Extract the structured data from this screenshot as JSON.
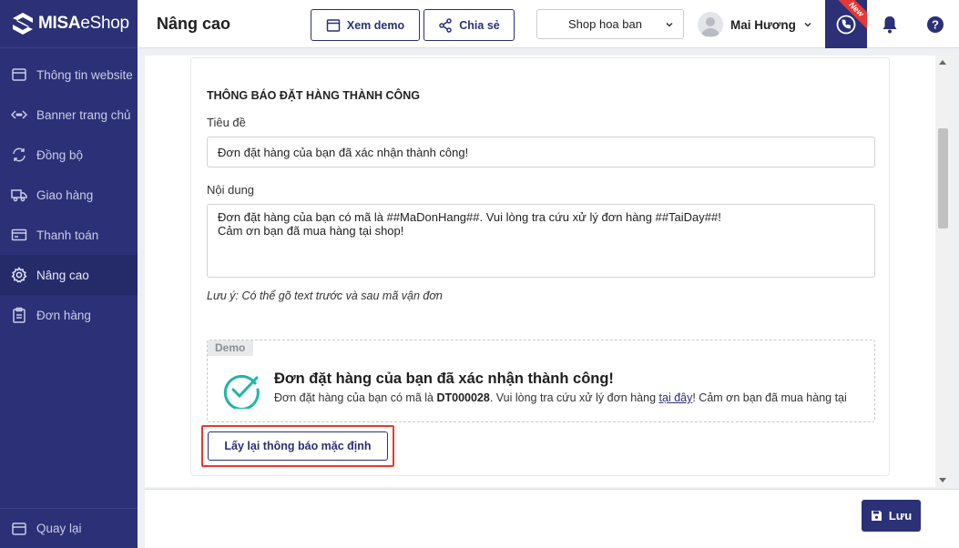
{
  "brand": {
    "name_bold": "MISA",
    "name_thin": "eShop"
  },
  "sidebar": {
    "items": [
      {
        "label": "Thông tin website",
        "icon": "browser-icon"
      },
      {
        "label": "Banner trang chủ",
        "icon": "banner-icon"
      },
      {
        "label": "Đồng bộ",
        "icon": "sync-icon"
      },
      {
        "label": "Giao hàng",
        "icon": "truck-icon"
      },
      {
        "label": "Thanh toán",
        "icon": "card-icon"
      },
      {
        "label": "Nâng cao",
        "icon": "gear-icon",
        "active": true
      },
      {
        "label": "Đơn hàng",
        "icon": "clipboard-icon"
      }
    ],
    "back_label": "Quay lại"
  },
  "header": {
    "title": "Nâng cao",
    "demo_button": "Xem demo",
    "share_button": "Chia sẻ",
    "shop_select": "Shop hoa ban",
    "user_name": "Mai Hương",
    "new_badge": "New"
  },
  "form": {
    "section_title": "THÔNG BÁO ĐẶT HÀNG THÀNH CÔNG",
    "title_label": "Tiêu đề",
    "title_value": "Đơn đặt hàng của bạn đã xác nhận thành công!",
    "content_label": "Nội dung",
    "content_value": "Đơn đặt hàng của bạn có mã là ##MaDonHang##. Vui lòng tra cứu xử lý đơn hàng ##TaiDay##!\nCảm ơn bạn đã mua hàng tại shop!",
    "note": "Lưu ý: Có thể gõ text trước và sau mã vận đơn"
  },
  "demo": {
    "tag": "Demo",
    "heading": "Đơn đặt hàng của bạn đã xác nhận thành công!",
    "text_before": "Đơn đặt hàng của bạn có mã là ",
    "order_code": "DT000028",
    "text_middle": ". Vui lòng tra cứu xử lý đơn hàng ",
    "link_text": "tại đây",
    "text_after": "! Cảm ơn bạn đã mua hàng tại"
  },
  "reset_button": "Lấy lại thông báo mặc định",
  "footer": {
    "save_button": "Lưu"
  },
  "colors": {
    "primary": "#2b3077",
    "highlight": "#e53935",
    "success": "#1fb5a8"
  }
}
